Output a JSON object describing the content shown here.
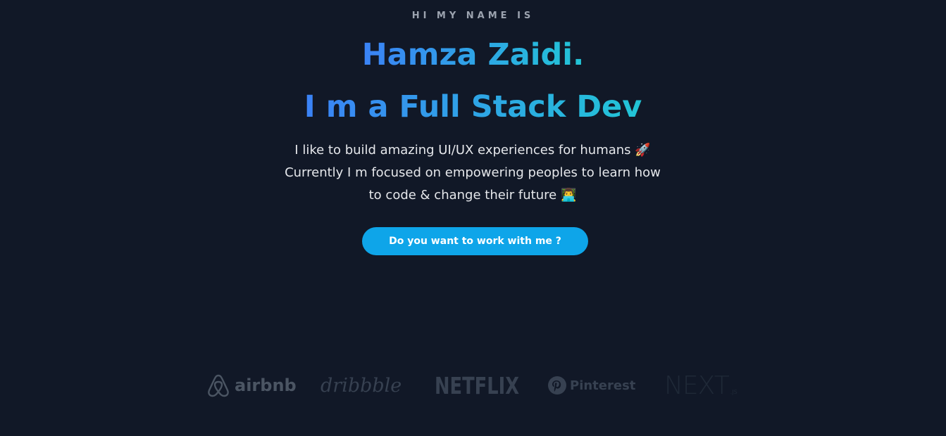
{
  "hero": {
    "eyebrow": "HI MY NAME IS",
    "name": "Hamza Zaidi.",
    "role": "I m a Full Stack Dev",
    "bio_lines": [
      "I like to build amazing UI/UX experiences for humans 🚀",
      "Currently I m focused on empowering peoples to learn how",
      "to code & change their future 👨‍💻"
    ],
    "cta_label": "Do you want to work with me ?"
  },
  "logos": {
    "airbnb": "airbnb",
    "dribbble": "dribbble",
    "netflix": "NETFLIX",
    "pinterest": "Pinterest",
    "next": "NEXT",
    "next_sub": ".JS"
  },
  "colors": {
    "background": "#111827",
    "accent_start": "#3b82f6",
    "accent_end": "#22c5d6",
    "button": "#0ea5e9"
  }
}
